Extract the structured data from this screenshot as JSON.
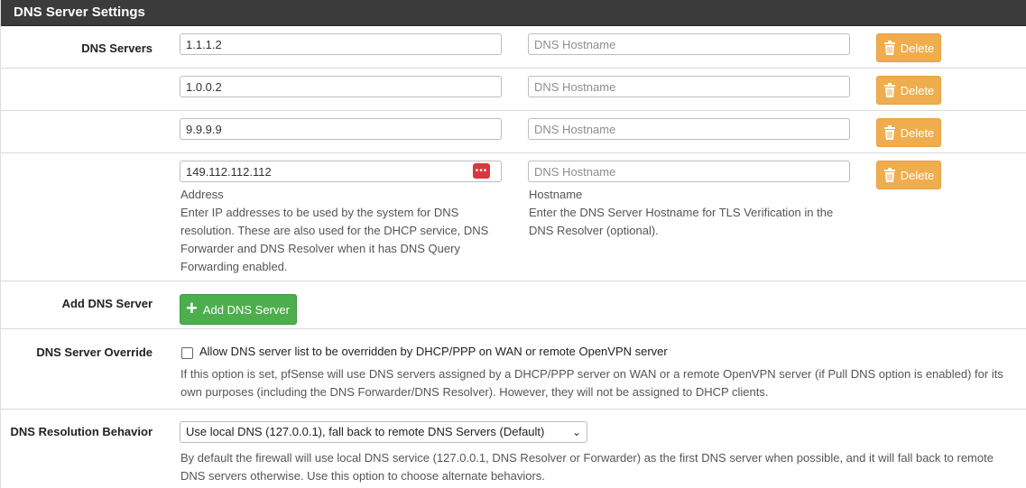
{
  "panel_title": "DNS Server Settings",
  "dns_servers": {
    "label": "DNS Servers",
    "host_placeholder": "DNS Hostname",
    "delete_label": "Delete",
    "entries": [
      {
        "address": "1.1.1.2",
        "hostname": ""
      },
      {
        "address": "1.0.0.2",
        "hostname": ""
      },
      {
        "address": "9.9.9.9",
        "hostname": ""
      },
      {
        "address": "149.112.112.112",
        "hostname": ""
      }
    ],
    "address_help_title": "Address",
    "address_help": "Enter IP addresses to be used by the system for DNS resolution. These are also used for the DHCP service, DNS Forwarder and DNS Resolver when it has DNS Query Forwarding enabled.",
    "hostname_help_title": "Hostname",
    "hostname_help": "Enter the DNS Server Hostname for TLS Verification in the DNS Resolver (optional)."
  },
  "add_dns": {
    "label": "Add DNS Server",
    "button_label": "Add DNS Server"
  },
  "override": {
    "label": "DNS Server Override",
    "checkbox_label": "Allow DNS server list to be overridden by DHCP/PPP on WAN or remote OpenVPN server",
    "checked": false,
    "help": "If this option is set, pfSense will use DNS servers assigned by a DHCP/PPP server on WAN or a remote OpenVPN server (if Pull DNS option is enabled) for its own purposes (including the DNS Forwarder/DNS Resolver). However, they will not be assigned to DHCP clients."
  },
  "resolution": {
    "label": "DNS Resolution Behavior",
    "selected": "Use local DNS (127.0.0.1), fall back to remote DNS Servers (Default)",
    "help": "By default the firewall will use local DNS service (127.0.0.1, DNS Resolver or Forwarder) as the first DNS server when possible, and it will fall back to remote DNS servers otherwise. Use this option to choose alternate behaviors."
  },
  "colors": {
    "header_bg": "#3b3b3b",
    "delete_button": "#f0ad4e",
    "add_button": "#4cae4c",
    "password_manager_icon": "#d9363e"
  }
}
